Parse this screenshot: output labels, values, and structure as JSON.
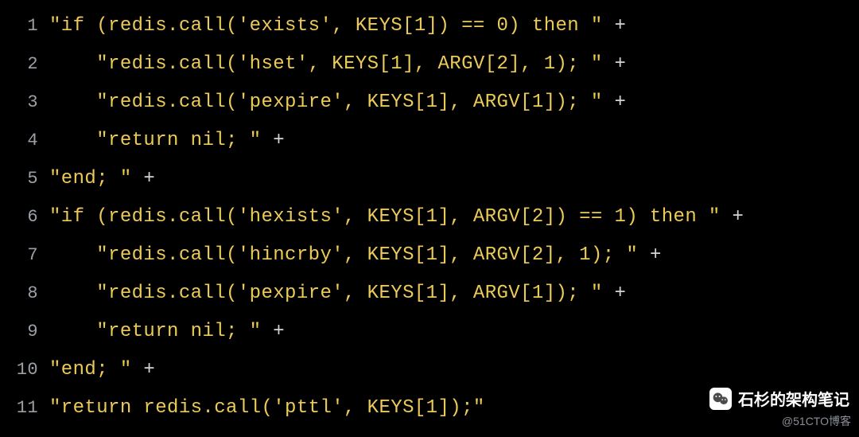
{
  "lines": [
    {
      "num": "1",
      "indent": 0,
      "str": "\"if (redis.call('exists', KEYS[1]) == 0) then \"",
      "tail": " +"
    },
    {
      "num": "2",
      "indent": 4,
      "str": "\"redis.call('hset', KEYS[1], ARGV[2], 1); \"",
      "tail": " +"
    },
    {
      "num": "3",
      "indent": 4,
      "str": "\"redis.call('pexpire', KEYS[1], ARGV[1]); \"",
      "tail": " +"
    },
    {
      "num": "4",
      "indent": 4,
      "str": "\"return nil; \"",
      "tail": " +"
    },
    {
      "num": "5",
      "indent": 0,
      "str": "\"end; \"",
      "tail": " +"
    },
    {
      "num": "6",
      "indent": 0,
      "str": "\"if (redis.call('hexists', KEYS[1], ARGV[2]) == 1) then \"",
      "tail": " +"
    },
    {
      "num": "7",
      "indent": 4,
      "str": "\"redis.call('hincrby', KEYS[1], ARGV[2], 1); \"",
      "tail": " +"
    },
    {
      "num": "8",
      "indent": 4,
      "str": "\"redis.call('pexpire', KEYS[1], ARGV[1]); \"",
      "tail": " +"
    },
    {
      "num": "9",
      "indent": 4,
      "str": "\"return nil; \"",
      "tail": " +"
    },
    {
      "num": "10",
      "indent": 0,
      "str": "\"end; \"",
      "tail": " +"
    },
    {
      "num": "11",
      "indent": 0,
      "str": "\"return redis.call('pttl', KEYS[1]);\"",
      "tail": ""
    }
  ],
  "watermark": {
    "badge_text": "石杉的架构笔记",
    "credit_text": "@51CTO博客",
    "icon_name": "wechat-icon"
  }
}
